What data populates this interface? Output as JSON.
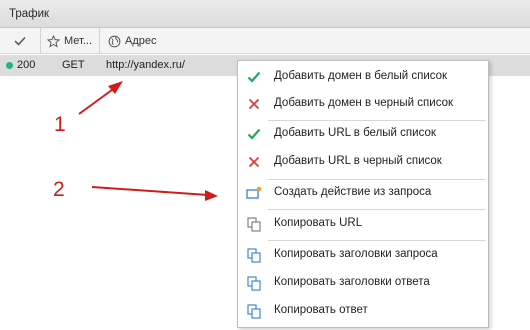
{
  "panel": {
    "title": "Трафик"
  },
  "columns": {
    "method_label": "Мет...",
    "address_label": "Адрес"
  },
  "row": {
    "status": "200",
    "method": "GET",
    "url": "http://yandex.ru/",
    "status_color": "#1fb57f"
  },
  "annotations": {
    "one": "1",
    "two": "2",
    "color": "#d11c1c"
  },
  "menu": {
    "items": [
      {
        "label": "Добавить домен в белый список",
        "icon": "check-icon"
      },
      {
        "label": "Добавить домен в черный список",
        "icon": "cross-icon"
      },
      {
        "label": "Добавить URL в белый список",
        "icon": "check-icon"
      },
      {
        "label": "Добавить URL в черный список",
        "icon": "cross-icon"
      },
      {
        "label": "Создать действие из запроса",
        "icon": "create-action-icon"
      },
      {
        "label": "Копировать URL",
        "icon": "copy-icon"
      },
      {
        "label": "Копировать заголовки запроса",
        "icon": "copy-icon"
      },
      {
        "label": "Копировать заголовки ответа",
        "icon": "copy-icon"
      },
      {
        "label": "Копировать ответ",
        "icon": "copy-icon"
      }
    ]
  },
  "colors": {
    "check": "#1faa5a",
    "cross": "#e03c3c",
    "copy": "#2f7fd3",
    "accent_dot": "#f0a020"
  }
}
